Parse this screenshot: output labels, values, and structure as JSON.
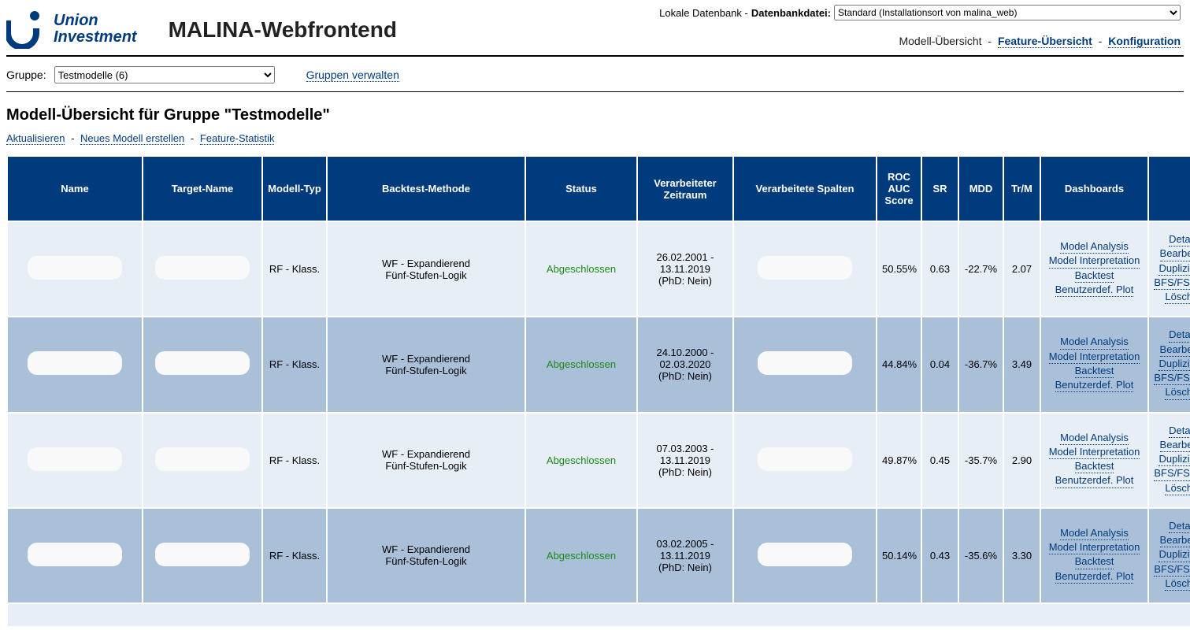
{
  "brand": {
    "line1": "Union",
    "line2": "Investment"
  },
  "app_title": "MALINA-Webfrontend",
  "db": {
    "label_prefix": "Lokale Datenbank - ",
    "label_bold": "Datenbankdatei:",
    "selected": "Standard (Installationsort von malina_web)"
  },
  "nav": {
    "current": "Modell-Übersicht",
    "feature": "Feature-Übersicht",
    "config": "Konfiguration",
    "sep": " - "
  },
  "group_bar": {
    "label": "Gruppe:",
    "selected": "Testmodelle (6)",
    "manage": "Gruppen verwalten"
  },
  "page_heading": "Modell-Übersicht für Gruppe \"Testmodelle\"",
  "actions": {
    "refresh": "Aktualisieren",
    "new_model": "Neues Modell erstellen",
    "feat_stat": "Feature-Statistik",
    "sep": " - "
  },
  "table": {
    "headers": {
      "name": "Name",
      "target": "Target-Name",
      "mtype": "Modell-Typ",
      "method": "Backtest-Methode",
      "status": "Status",
      "period": "Verarbeiteter Zeitraum",
      "cols": "Verarbeitete Spalten",
      "roc": "ROC AUC Score",
      "sr": "SR",
      "mdd": "MDD",
      "trm": "Tr/M",
      "dash": "Dashboards",
      "act": ""
    },
    "dash_labels": {
      "ma": "Model Analysis",
      "mi": "Model Interpretation",
      "bt": "Backtest",
      "bp": "Benutzerdef. Plot"
    },
    "act_labels": {
      "details": "Details",
      "edit": "Bearbeiten",
      "dup": "Duplizieren",
      "bfs": "BFS/FS/HPO",
      "del": "Löschen"
    },
    "rows": [
      {
        "mtype": "RF - Klass.",
        "method_l1": "WF - Expandierend",
        "method_l2": "Fünf-Stufen-Logik",
        "status": "Abgeschlossen",
        "period_l1": "26.02.2001 -",
        "period_l2": "13.11.2019",
        "period_l3": "(PhD: Nein)",
        "roc": "50.55%",
        "sr": "0.63",
        "mdd": "-22.7%",
        "trm": "2.07"
      },
      {
        "mtype": "RF - Klass.",
        "method_l1": "WF - Expandierend",
        "method_l2": "Fünf-Stufen-Logik",
        "status": "Abgeschlossen",
        "period_l1": "24.10.2000 -",
        "period_l2": "02.03.2020",
        "period_l3": "(PhD: Nein)",
        "roc": "44.84%",
        "sr": "0.04",
        "mdd": "-36.7%",
        "trm": "3.49"
      },
      {
        "mtype": "RF - Klass.",
        "method_l1": "WF - Expandierend",
        "method_l2": "Fünf-Stufen-Logik",
        "status": "Abgeschlossen",
        "period_l1": "07.03.2003 -",
        "period_l2": "13.11.2019",
        "period_l3": "(PhD: Nein)",
        "roc": "49.87%",
        "sr": "0.45",
        "mdd": "-35.7%",
        "trm": "2.90"
      },
      {
        "mtype": "RF - Klass.",
        "method_l1": "WF - Expandierend",
        "method_l2": "Fünf-Stufen-Logik",
        "status": "Abgeschlossen",
        "period_l1": "03.02.2005 -",
        "period_l2": "13.11.2019",
        "period_l3": "(PhD: Nein)",
        "roc": "50.14%",
        "sr": "0.43",
        "mdd": "-35.6%",
        "trm": "3.30"
      }
    ]
  }
}
